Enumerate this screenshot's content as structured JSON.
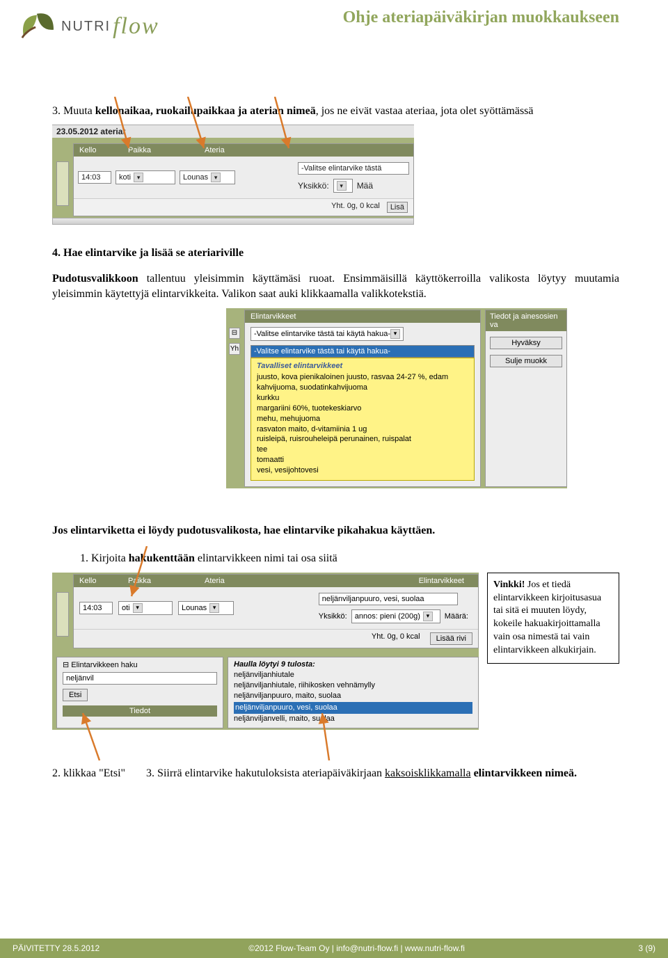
{
  "doc_title": "Ohje ateriapäiväkirjan muokkaukseen",
  "logo": {
    "brand": "NUTRI",
    "script": "flow"
  },
  "p3": {
    "prefix": "3. Muuta ",
    "bold": "kellonaikaa, ruokailupaikkaa ja aterian nimeä",
    "suffix": ", jos ne eivät vastaa ateriaa, jota olet syöttämässä"
  },
  "sc1": {
    "date_header": "23.05.2012 ateriat",
    "cols": {
      "kello": "Kello",
      "paikka": "Paikka",
      "ateria": "Ateria"
    },
    "row": {
      "time": "14:03",
      "place": "koti",
      "meal": "Lounas"
    },
    "right": {
      "dropdown_placeholder": "-Valitse elintarvike tästä",
      "unit_label": "Yksikkö:",
      "amount_label": "Mää"
    },
    "footer": {
      "total": "Yht. 0g, 0 kcal",
      "btn": "Lisä"
    }
  },
  "p4": {
    "line1_bold": "4. Hae elintarvike ja lisää se ateriariville",
    "line2_bold": "Pudotusvalikkoon",
    "line2_rest": " tallentuu yleisimmin käyttämäsi ruoat. Ensimmäisillä käyttökerroilla valikosta löytyy muutamia yleisimmin käytettyjä elintarvikkeita. Valikon saat auki klikkaamalla valikkotekstiä."
  },
  "sc2": {
    "header_tab": "Elintarvikkeet",
    "select_text": "-Valitse elintarvike tästä tai käytä hakua-",
    "highlight_text": "-Valitse elintarvike tästä tai käytä hakua-",
    "yellow_header": "Tavalliset elintarvikkeet",
    "foods": [
      "juusto, kova pienikaloinen juusto, rasvaa 24-27 %, edam",
      "kahvijuoma, suodatinkahvijuoma",
      "kurkku",
      "margariini 60%, tuotekeskiarvo",
      "mehu, mehujuoma",
      "rasvaton maito, d-vitamiinia 1 ug",
      "ruisleipä, ruisrouheleipä perunainen, ruispalat",
      "tee",
      "tomaatti",
      "vesi, vesijohtovesi"
    ],
    "right": {
      "tab": "Tiedot ja ainesosien va",
      "btn1": "Hyväksy",
      "btn2": "Sulje muokk"
    },
    "left_label": "Yh"
  },
  "p_nosearch": "Jos elintarviketta ei löydy pudotusvalikosta, hae elintarvike pikahakua käyttäen.",
  "p_step1": {
    "num": "1. ",
    "before": "Kirjoita ",
    "bold": "hakukenttään",
    "after": " elintarvikkeen nimi tai osa siitä"
  },
  "tip": {
    "bold": "Vinkki!",
    "text": " Jos et tiedä elintarvikkeen kirjoitusasua tai sitä ei muuten löydy, kokeile hakuakirjoittamalla vain osa nimestä tai vain elintarvikkeen alkukirjain."
  },
  "sc3": {
    "cols": {
      "kello": "Kello",
      "paikka": "Paikka",
      "ateria": "Ateria",
      "elin": "Elintarvikkeet"
    },
    "row": {
      "time": "14:03",
      "place": "oti",
      "meal": "Lounas"
    },
    "right": {
      "selected": "neljänviljanpuuro, vesi, suolaa",
      "unit_label": "Yksikkö:",
      "unit_value": "annos: pieni (200g)",
      "amount_label": "Määrä:"
    },
    "footer": {
      "total": "Yht. 0g, 0 kcal",
      "btn": "Lisää rivi"
    },
    "search": {
      "panel_title": "⊟ Elintarvikkeen haku",
      "input_value": "neljänvil",
      "etsi": "Etsi",
      "tiedot": "Tiedot",
      "results_header": "Haulla löytyi 9 tulosta:",
      "results": [
        "neljänviljanhiutale",
        "neljänviljanhiutale, riihikosken vehnämylly",
        "neljänviljanpuuro, maito, suolaa"
      ],
      "result_hl": "neljänviljanpuuro, vesi, suolaa",
      "result_last": "neljänviljanvelli, maito, suolaa"
    }
  },
  "summary": {
    "c1": "2. klikkaa \"Etsi\"",
    "c2_before": "3. Siirrä elintarvike hakutuloksista ateriapäiväkirjaan ",
    "c2_under": "kaksoisklikkamalla",
    "c2_after": " elintarvikkeen nimeä."
  },
  "footer": {
    "updated": "PÄIVITETTY 28.5.2012",
    "copy": "©2012 Flow-Team Oy | info@nutri-flow.fi | www.nutri-flow.fi",
    "page": "3 (9)"
  }
}
